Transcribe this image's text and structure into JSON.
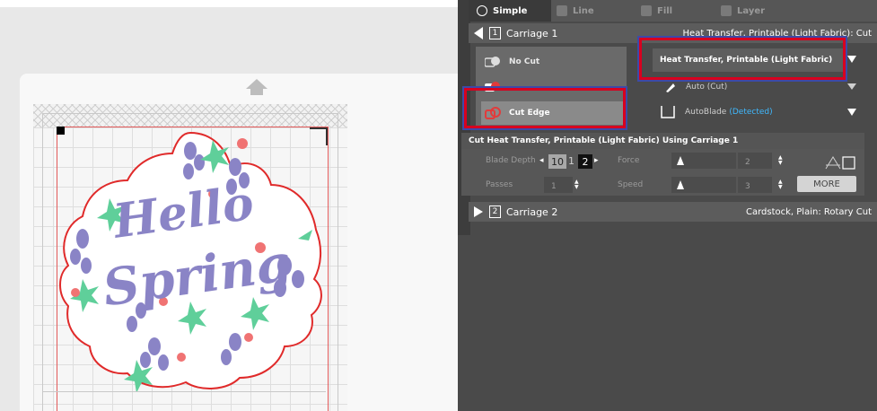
{
  "tabs": [
    {
      "label": "Simple",
      "icon": "radio-icon",
      "active": true
    },
    {
      "label": "Line",
      "icon": "line-icon",
      "active": false
    },
    {
      "label": "Fill",
      "icon": "fill-icon",
      "active": false
    },
    {
      "label": "Layer",
      "icon": "layer-icon",
      "active": false
    }
  ],
  "carriage1": {
    "number": "1",
    "name": "Carriage 1",
    "material_summary": "Heat Transfer, Printable (Light Fabric): Cut"
  },
  "cut_options": [
    {
      "label": "No Cut",
      "icon": "no-cut-icon",
      "selected": false
    },
    {
      "label": "",
      "icon": "kiss-cut-icon",
      "selected": false
    },
    {
      "label": "Cut Edge",
      "icon": "cut-edge-icon",
      "selected": true
    }
  ],
  "material": {
    "value": "Heat Transfer, Printable (Light Fabric)"
  },
  "action": {
    "value": "Auto (Cut)"
  },
  "blade": {
    "value": "AutoBlade",
    "status": "(Detected)"
  },
  "settings": {
    "header": "Cut Heat Transfer, Printable (Light Fabric) Using Carriage 1",
    "blade_depth_label": "Blade Depth",
    "blade_depth_value_1": "10",
    "blade_depth_value_2": "1",
    "blade_depth_value_3": "2",
    "force_label": "Force",
    "force_value": "2",
    "passes_label": "Passes",
    "passes_value": "1",
    "speed_label": "Speed",
    "speed_value": "3",
    "more_label": "MORE"
  },
  "carriage2": {
    "number": "2",
    "name": "Carriage 2",
    "material_summary": "Cardstock, Plain: Rotary Cut"
  },
  "artwork_text": {
    "line1": "Hello",
    "line2": "Spring"
  },
  "colors": {
    "accent_highlight": "#d8001f",
    "detected": "#3fb9ff",
    "artwork_purple": "#8a84c6",
    "leaf_green": "#5fcf9a",
    "flower_pink": "#f07373"
  }
}
